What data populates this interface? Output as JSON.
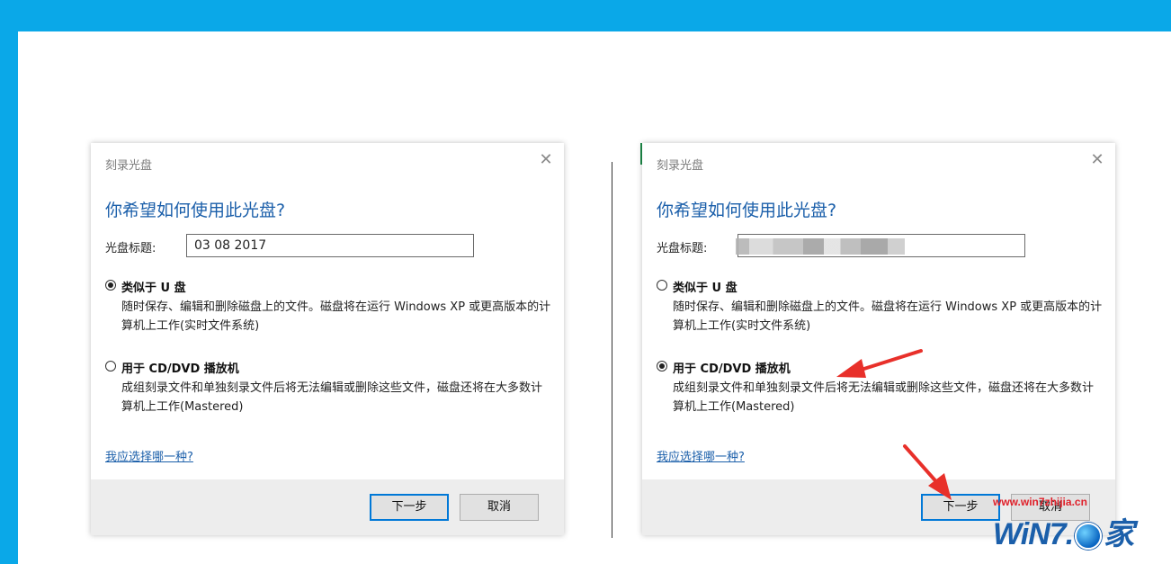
{
  "dialog_left": {
    "title": "刻录光盘",
    "close_glyph": "✕",
    "heading": "你希望如何使用此光盘?",
    "disc_title_label": "光盘标题:",
    "disc_title_value": "03 08 2017",
    "option1": {
      "label": "类似于 U 盘",
      "description": "随时保存、编辑和删除磁盘上的文件。磁盘将在运行 Windows XP 或更高版本的计算机上工作(实时文件系统)",
      "selected": true
    },
    "option2": {
      "label": "用于 CD/DVD 播放机",
      "description": "成组刻录文件和单独刻录文件后将无法编辑或删除这些文件，磁盘还将在大多数计算机上工作(Mastered)",
      "selected": false
    },
    "help_link": "我应选择哪一种?",
    "next_button": "下一步",
    "cancel_button": "取消"
  },
  "dialog_right": {
    "title": "刻录光盘",
    "close_glyph": "✕",
    "heading": "你希望如何使用此光盘?",
    "disc_title_label": "光盘标题:",
    "disc_title_value": "",
    "option1": {
      "label": "类似于 U 盘",
      "description": "随时保存、编辑和删除磁盘上的文件。磁盘将在运行 Windows XP 或更高版本的计算机上工作(实时文件系统)",
      "selected": false
    },
    "option2": {
      "label": "用于 CD/DVD 播放机",
      "description": "成组刻录文件和单独刻录文件后将无法编辑或删除这些文件，磁盘还将在大多数计算机上工作(Mastered)",
      "selected": true
    },
    "help_link": "我应选择哪一种?",
    "next_button": "下一步",
    "cancel_button": "取消"
  },
  "watermark": {
    "url": "www.win7zhijia.cn",
    "logo_text_a": "WiN7.",
    "logo_text_b": "家"
  },
  "colors": {
    "frame": "#0aa8e8",
    "heading_blue": "#1b5faa",
    "arrow_red": "#e8302a",
    "watermark_red": "#e0202a"
  }
}
